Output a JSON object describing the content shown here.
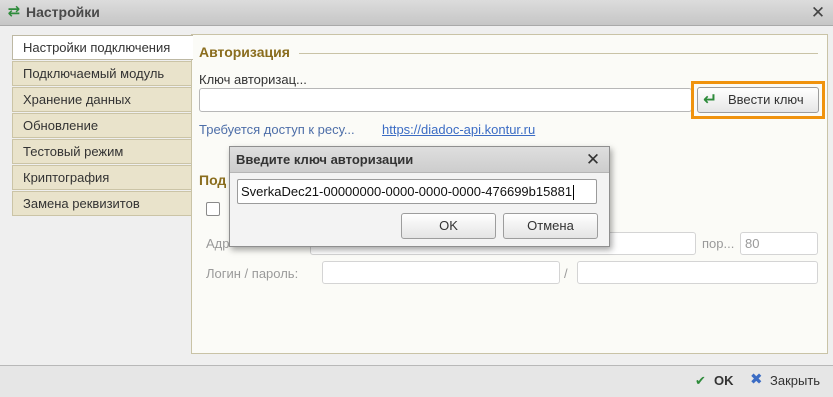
{
  "window": {
    "title": "Настройки",
    "title_icon": "arrows-exchange-icon",
    "close_icon": "close-icon"
  },
  "tabs": [
    {
      "label": "Настройки подключения",
      "active": true
    },
    {
      "label": "Подключаемый модуль",
      "active": false
    },
    {
      "label": "Хранение данных",
      "active": false
    },
    {
      "label": "Обновление",
      "active": false
    },
    {
      "label": "Тестовый режим",
      "active": false
    },
    {
      "label": "Криптография",
      "active": false
    },
    {
      "label": "Замена реквизитов",
      "active": false
    }
  ],
  "auth": {
    "section_title": "Авторизация",
    "key_label": "Ключ авторизац...",
    "key_value": "",
    "enter_key_button": "Ввести ключ",
    "enter_key_icon": "enter-arrow-icon",
    "access_text": "Требуется доступ к ресу...",
    "access_link": "https://diadoc-api.kontur.ru"
  },
  "proxy": {
    "section_title_visible": "Под",
    "address_label_visible": "Адр",
    "port_label_visible": "пор...",
    "port_value": "80",
    "login_label": "Логин / пароль:",
    "slash": "/"
  },
  "dialog": {
    "title": "Введите ключ авторизации",
    "input_value": "SverkaDec21-00000000-0000-0000-0000-476699b15881",
    "ok_label": "OK",
    "cancel_label": "Отмена"
  },
  "bottom": {
    "ok_label": "OK",
    "close_label": "Закрыть"
  },
  "colors": {
    "highlight": "#f0930d",
    "section_title": "#8a6d1e",
    "link": "#3b6cc4",
    "tab_bg": "#e9e3cb"
  }
}
